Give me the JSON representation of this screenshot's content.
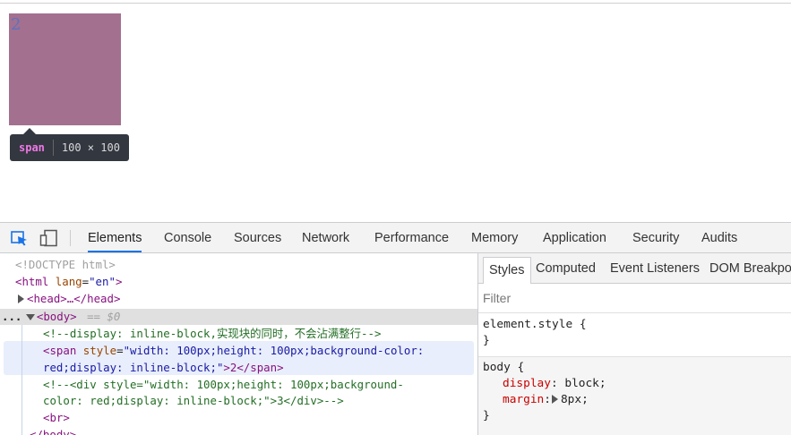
{
  "viewport": {
    "span_text": "2",
    "tooltip": {
      "tag": "span",
      "size": "100 × 100"
    }
  },
  "devtools": {
    "tabs": [
      "Elements",
      "Console",
      "Sources",
      "Network",
      "Performance",
      "Memory",
      "Application",
      "Security",
      "Audits"
    ],
    "active_tab": "Elements",
    "icons": [
      "inspect-element-icon",
      "device-toolbar-icon"
    ]
  },
  "elements": {
    "doctype": "<!DOCTYPE html>",
    "html_open": "<html",
    "html_attr": "lang",
    "html_val": "\"en\"",
    "html_close": ">",
    "head_collapsed": "<head>…</head>",
    "body_open": "<body>",
    "body_marker": "== $0",
    "comment1": "<!--display: inline-block,实现块的同时，不会沾满整行-->",
    "span_open": "<span",
    "span_attr": "style",
    "span_val_1": "\"width: 100px;height: 100px;background-color:",
    "span_val_2": "red;display: inline-block;\"",
    "span_inner": ">2</span>",
    "comment2_1": "<!--<div style=\"width: 100px;height: 100px;background-",
    "comment2_2": "color: red;display: inline-block;\">3</div>-->",
    "br": "<br>",
    "body_close": "</body>",
    "ellipsis": "..."
  },
  "styles": {
    "tabs": [
      "Styles",
      "Computed",
      "Event Listeners",
      "DOM Breakpoints"
    ],
    "active_tab": "Styles",
    "filter_placeholder": "Filter",
    "element_style_selector": "element.style {",
    "close_brace": "}",
    "body_selector": "body {",
    "declarations": [
      {
        "prop": "display",
        "value": "block;"
      },
      {
        "prop": "margin",
        "value": "8px;"
      }
    ]
  }
}
